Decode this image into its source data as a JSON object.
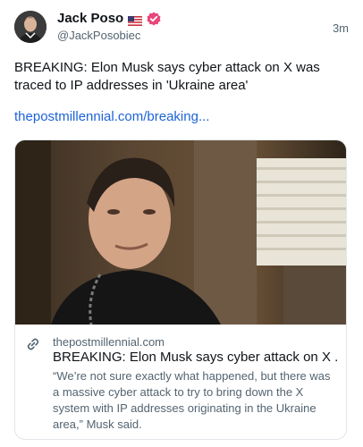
{
  "author": {
    "name": "Jack Poso",
    "handle": "@JackPosobiec",
    "flag_icon": "us-flag-icon",
    "verified_icon": "verified-badge-icon",
    "verified_color": "#e8477a"
  },
  "timestamp": "3m",
  "post": {
    "text": "BREAKING: Elon Musk says cyber attack on X was traced to IP addresses in 'Ukraine area'",
    "link": "thepostmillennial.com/breaking..."
  },
  "card": {
    "link_icon": "link-icon",
    "domain": "thepostmillennial.com",
    "title": "BREAKING: Elon Musk says cyber attack on X ...",
    "description": "“We’re not sure exactly what happened, but there was a massive cyber attack to try to bring down the X system with IP addresses originating in the Ukraine area,” Musk said."
  },
  "colors": {
    "link": "#1d63d8",
    "secondary_text": "#536471",
    "border": "#e1e6ea"
  }
}
